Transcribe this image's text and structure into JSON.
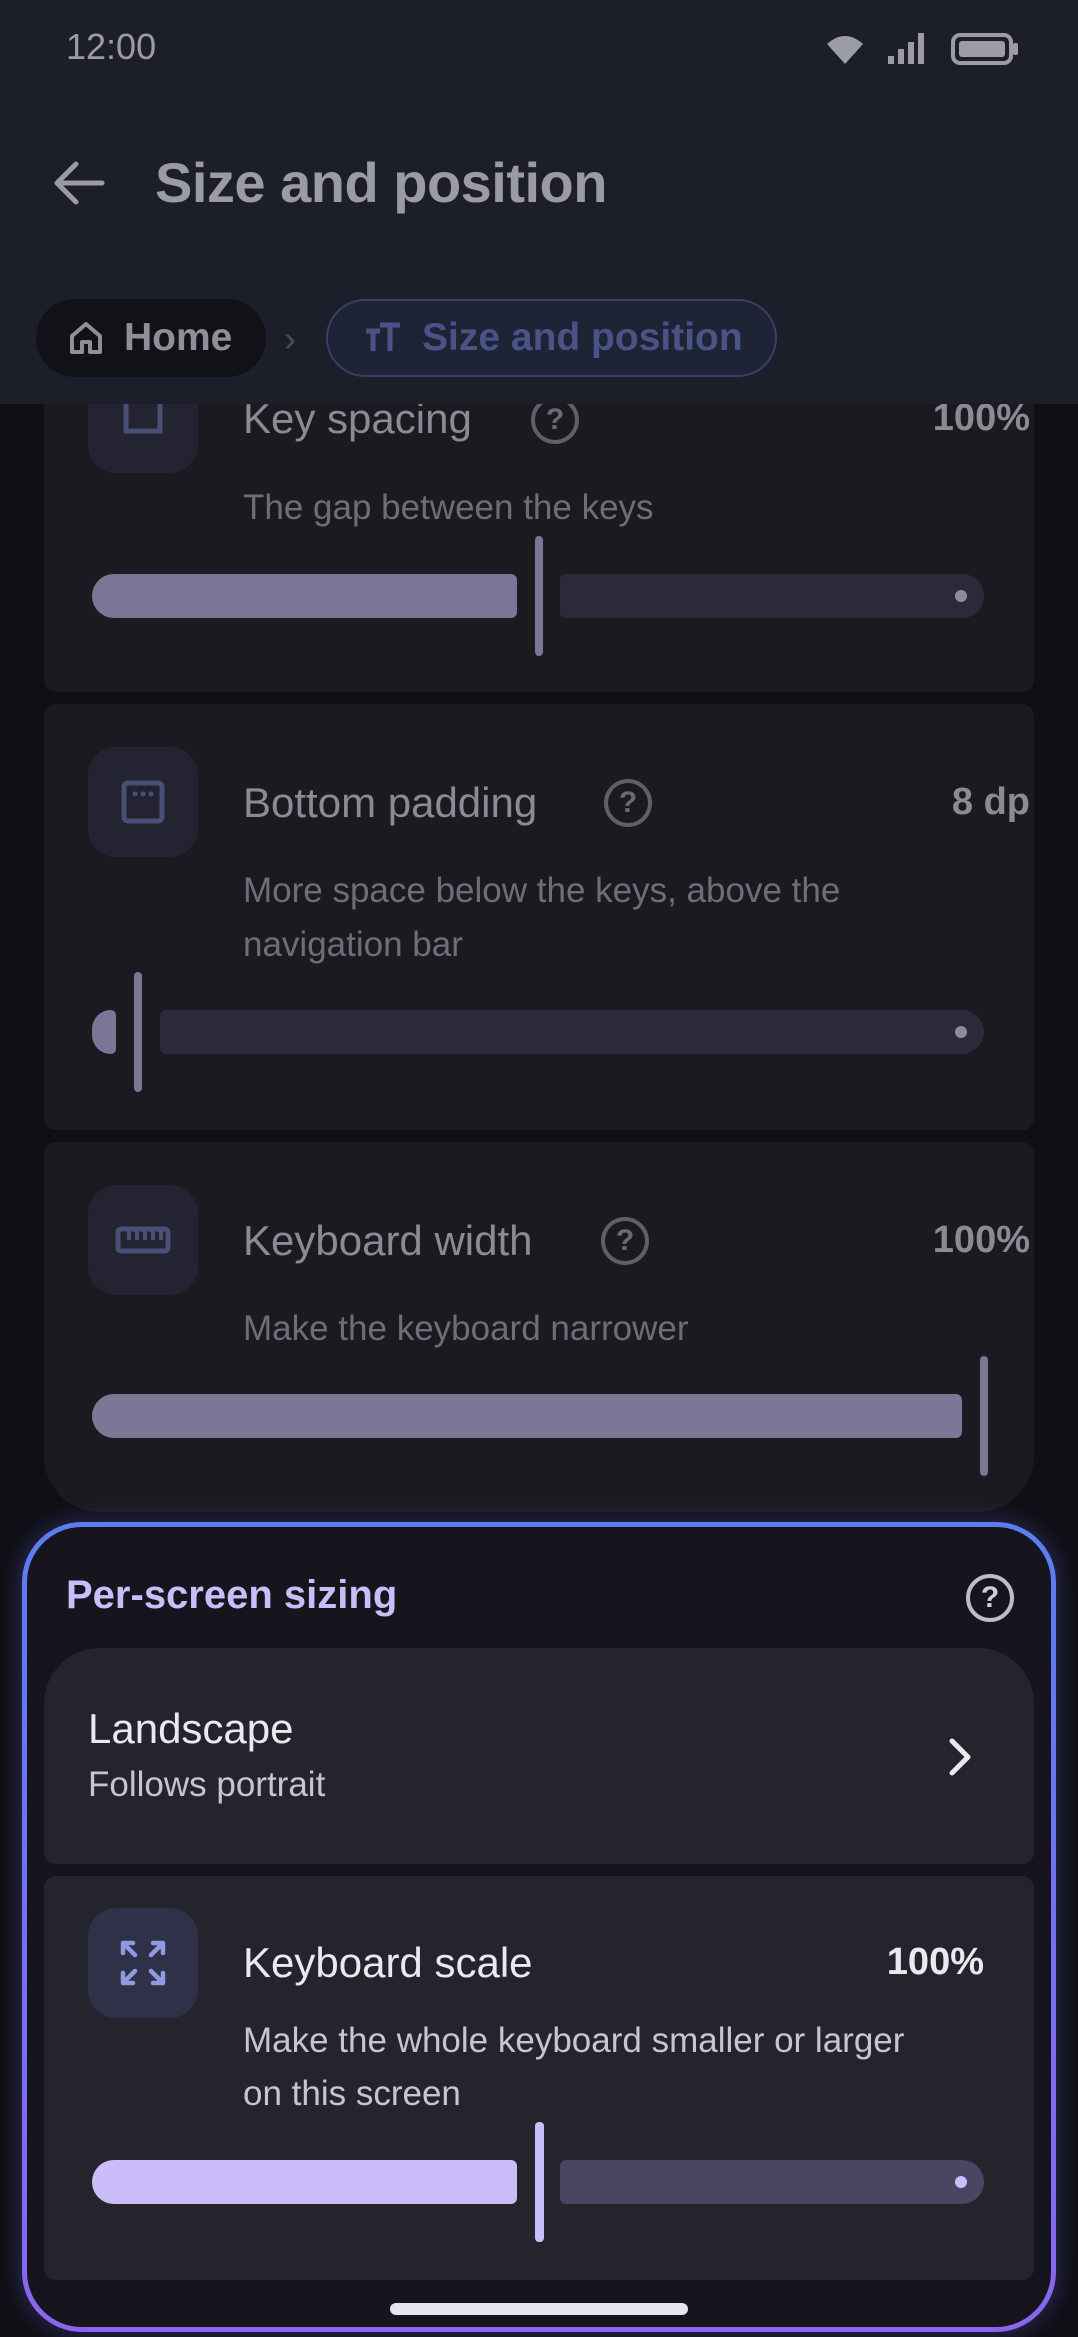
{
  "status_bar": {
    "time": "12:00"
  },
  "header": {
    "title": "Size and position",
    "breadcrumb": {
      "home": "Home",
      "current": "Size and position"
    }
  },
  "settings": [
    {
      "title": "Key spacing",
      "value": "100%",
      "subtitle": "The gap between the keys",
      "slider_fraction": 0.5
    },
    {
      "title": "Bottom padding",
      "value": "8 dp",
      "subtitle": "More space below the keys, above the navigation bar",
      "slider_fraction": 0.05
    },
    {
      "title": "Keyboard width",
      "value": "100%",
      "subtitle": "Make the keyboard narrower",
      "slider_fraction": 1.0
    }
  ],
  "per_screen": {
    "title": "Per-screen sizing",
    "landscape": {
      "title": "Landscape",
      "subtitle": "Follows portrait"
    },
    "scale": {
      "title": "Keyboard scale",
      "value": "100%",
      "subtitle": "Make the whole keyboard smaller or larger on this screen",
      "slider_fraction": 0.5
    }
  },
  "colors": {
    "accent": "#cbbdfa",
    "highlight_border_start": "#5a7ef0",
    "highlight_border_end": "#8a66f0",
    "header_bg": "#1c1e2a"
  },
  "icons": {
    "back": "arrow-left-icon",
    "home": "home-icon",
    "text_size": "text-size-icon",
    "help": "help-circle-icon",
    "padding": "bottom-padding-icon",
    "width": "ruler-icon",
    "scale": "expand-icon",
    "chevron": "chevron-right-icon"
  }
}
